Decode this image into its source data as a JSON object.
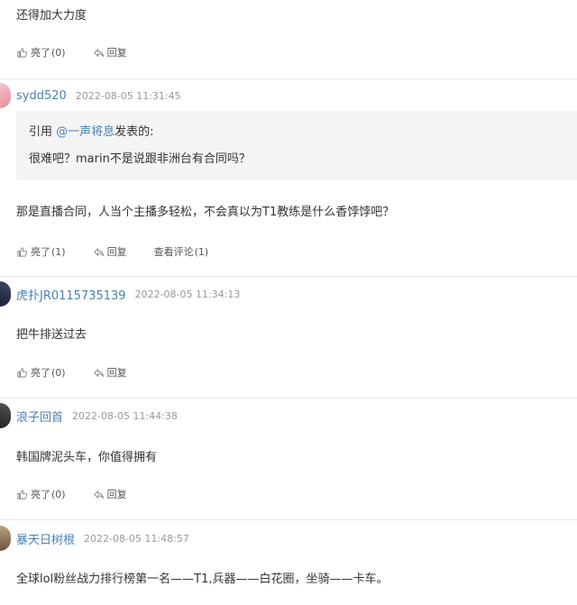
{
  "comments": [
    {
      "text": "还得加大力度",
      "like_label": "亮了",
      "like_count": "(0)",
      "reply_label": "回复"
    },
    {
      "username": "sydd520",
      "time": "2022-08-05 11:31:45",
      "quote": {
        "prefix": "引用 ",
        "user": "@一声将息",
        "suffix": "发表的:",
        "text": "很难吧？marin不是说跟非洲台有合同吗？"
      },
      "text": "那是直播合同，人当个主播多轻松，不会真以为T1教练是什么香饽饽吧？",
      "like_label": "亮了",
      "like_count": "(1)",
      "reply_label": "回复",
      "view_label": "查看评论",
      "view_count": "(1)"
    },
    {
      "username": "虎扑JR0115735139",
      "time": "2022-08-05 11:34:13",
      "text": "把牛排送过去",
      "like_label": "亮了",
      "like_count": "(0)",
      "reply_label": "回复"
    },
    {
      "username": "浪子回首",
      "time": "2022-08-05 11:44:38",
      "text": "韩国牌泥头车，你值得拥有",
      "like_label": "亮了",
      "like_count": "(0)",
      "reply_label": "回复"
    },
    {
      "username": "暴天日树根",
      "time": "2022-08-05 11:48:57",
      "text": "全球lol粉丝战力排行榜第一名——T1,兵器——白花圈，坐骑——卡车。"
    }
  ],
  "colors": {
    "link": "#4a7fb5",
    "meta": "#999999",
    "divider": "#e9e9e9",
    "quote_bg": "#f4f4f4"
  }
}
